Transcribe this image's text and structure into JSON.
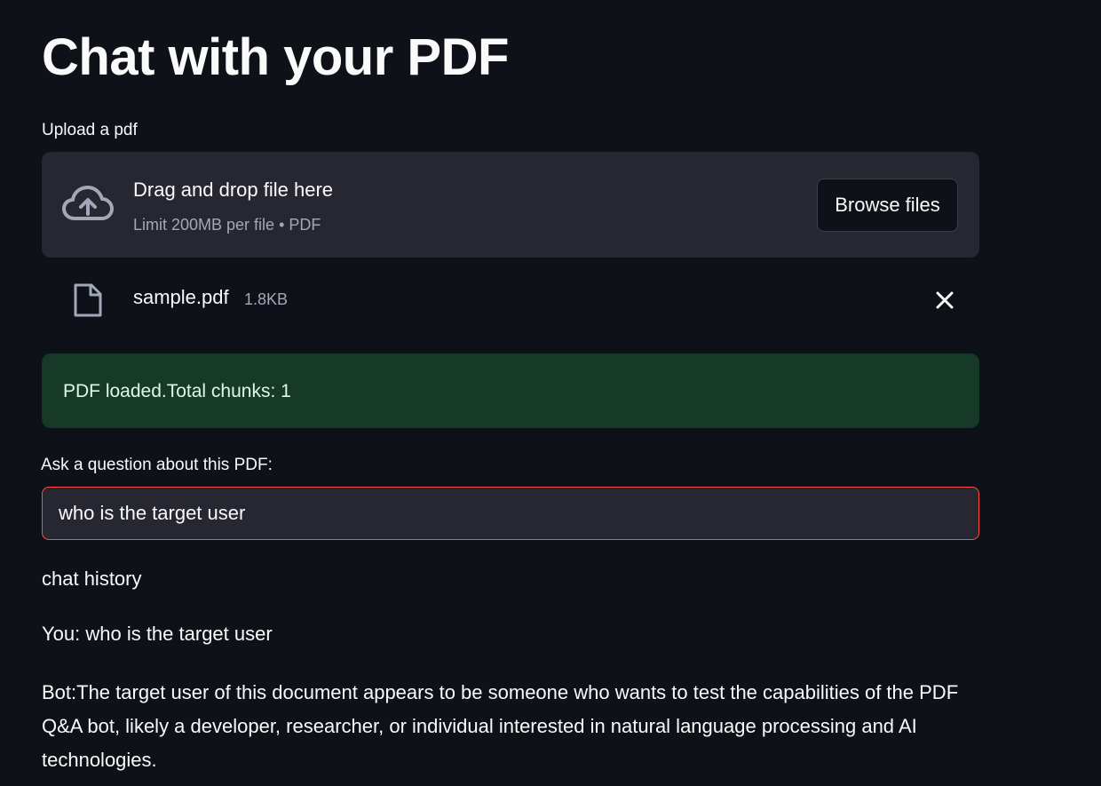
{
  "header": {
    "title": "Chat with your PDF"
  },
  "uploader": {
    "label": "Upload a pdf",
    "drop_title": "Drag and drop file here",
    "drop_subtitle": "Limit 200MB per file • PDF",
    "browse_label": "Browse files",
    "icon": "cloud-upload-icon"
  },
  "uploaded_file": {
    "name": "sample.pdf",
    "size": "1.8KB",
    "icon": "file-icon",
    "remove_icon": "close-icon"
  },
  "status": {
    "message": "PDF loaded.Total chunks: 1",
    "color": "#173928"
  },
  "question": {
    "label": "Ask a question about this PDF:",
    "value": "who is the target user"
  },
  "chat": {
    "heading": "chat history",
    "messages": [
      {
        "text": "You: who is the target user"
      },
      {
        "text": "Bot:The target user of this document appears to be someone who wants to test the capabilities of the PDF Q&A bot, likely a developer, researcher, or individual interested in natural language processing and AI technologies."
      }
    ]
  },
  "colors": {
    "background": "#0e1117",
    "panel": "#262730",
    "accent": "#ff4b4b"
  }
}
